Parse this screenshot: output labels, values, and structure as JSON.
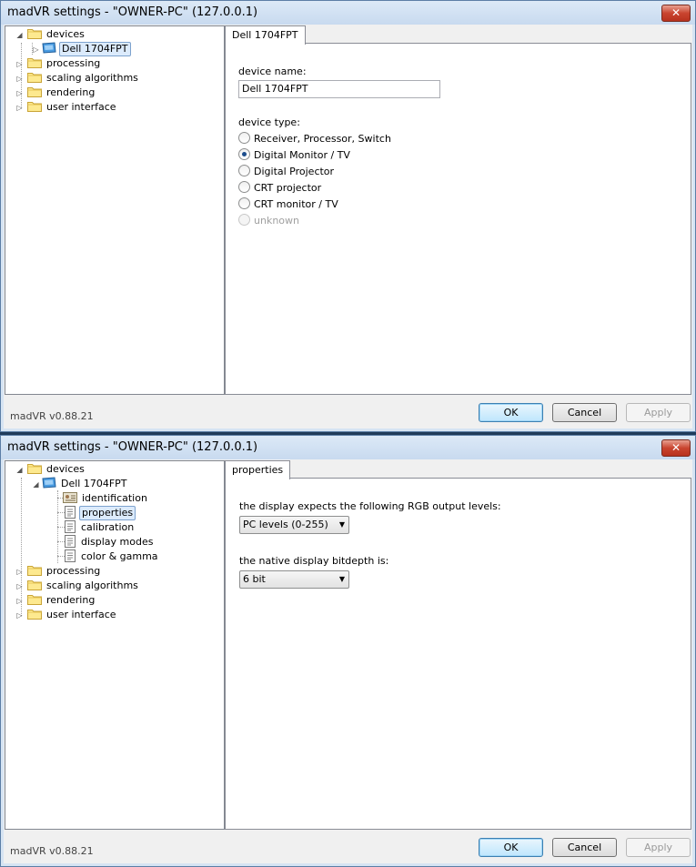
{
  "window1": {
    "title": "madVR settings - \"OWNER-PC\" (127.0.0.1)",
    "close": "✕",
    "tree": {
      "devices": "devices",
      "device": "Dell 1704FPT",
      "processing": "processing",
      "scaling": "scaling algorithms",
      "rendering": "rendering",
      "ui": "user interface"
    },
    "tab": "Dell 1704FPT",
    "device_name_label": "device name:",
    "device_name_value": "Dell 1704FPT",
    "device_type_label": "device type:",
    "device_types": [
      "Receiver, Processor, Switch",
      "Digital Monitor / TV",
      "Digital Projector",
      "CRT projector",
      "CRT monitor / TV",
      "unknown"
    ],
    "selected_type": "Digital Monitor / TV",
    "version": "madVR v0.88.21",
    "ok": "OK",
    "cancel": "Cancel",
    "apply": "Apply"
  },
  "window2": {
    "title": "madVR settings - \"OWNER-PC\" (127.0.0.1)",
    "close": "✕",
    "tree": {
      "devices": "devices",
      "device": "Dell 1704FPT",
      "identification": "identification",
      "properties": "properties",
      "calibration": "calibration",
      "display_modes": "display modes",
      "color_gamma": "color & gamma",
      "processing": "processing",
      "scaling": "scaling algorithms",
      "rendering": "rendering",
      "ui": "user interface"
    },
    "tab": "properties",
    "rgb_label": "the display expects the following RGB output levels:",
    "rgb_value": "PC levels (0-255)",
    "bitdepth_label": "the native display bitdepth is:",
    "bitdepth_value": "6 bit",
    "version": "madVR v0.88.21",
    "ok": "OK",
    "cancel": "Cancel",
    "apply": "Apply"
  },
  "icons": {
    "folder": "folder-icon",
    "monitor": "monitor-icon",
    "document": "document-icon",
    "id_card": "id-card-icon"
  },
  "colors": {
    "title_bg": "#d6e4f3",
    "selection": "#dcebfc",
    "close": "#c9442f"
  }
}
